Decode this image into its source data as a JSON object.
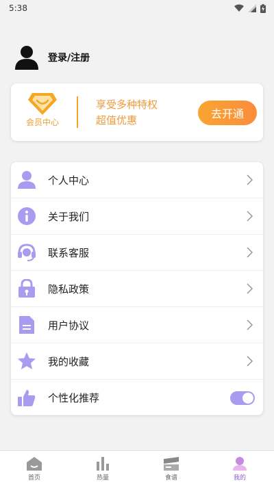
{
  "status_bar": {
    "time": "5:38"
  },
  "user": {
    "login_label": "登录/注册"
  },
  "vip": {
    "badge_label": "会员中心",
    "line1": "享受多种特权",
    "line2": "超值优惠",
    "button_label": "去开通"
  },
  "menu": {
    "items": [
      {
        "label": "个人中心"
      },
      {
        "label": "关于我们"
      },
      {
        "label": "联系客服"
      },
      {
        "label": "隐私政策"
      },
      {
        "label": "用户协议"
      },
      {
        "label": "我的收藏"
      },
      {
        "label": "个性化推荐"
      }
    ],
    "toggle_on": true
  },
  "nav": {
    "items": [
      {
        "label": "首页"
      },
      {
        "label": "热量"
      },
      {
        "label": "食谱"
      },
      {
        "label": "我的"
      }
    ],
    "active_index": 3
  },
  "colors": {
    "accent_purple": "#a99cf0",
    "vip_orange": "#f5a623",
    "active_nav": "#8c5cd6"
  }
}
